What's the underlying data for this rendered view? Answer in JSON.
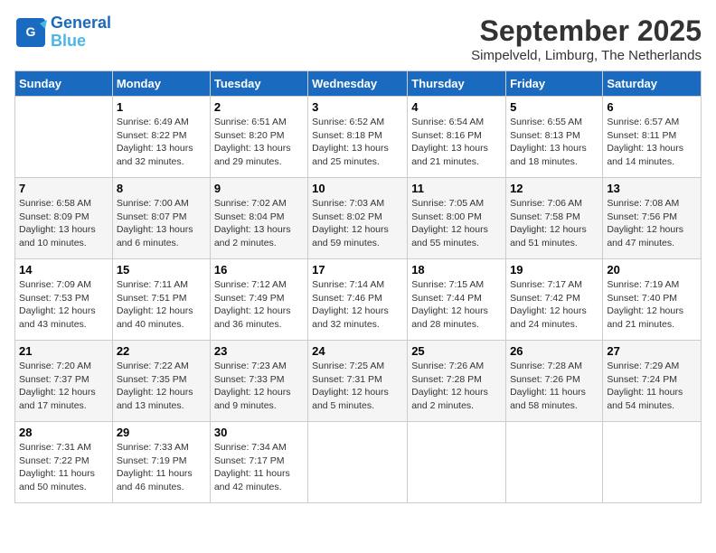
{
  "header": {
    "logo_line1": "General",
    "logo_line2": "Blue",
    "month": "September 2025",
    "location": "Simpelveld, Limburg, The Netherlands"
  },
  "days_of_week": [
    "Sunday",
    "Monday",
    "Tuesday",
    "Wednesday",
    "Thursday",
    "Friday",
    "Saturday"
  ],
  "weeks": [
    [
      {
        "day": "",
        "info": ""
      },
      {
        "day": "1",
        "info": "Sunrise: 6:49 AM\nSunset: 8:22 PM\nDaylight: 13 hours\nand 32 minutes."
      },
      {
        "day": "2",
        "info": "Sunrise: 6:51 AM\nSunset: 8:20 PM\nDaylight: 13 hours\nand 29 minutes."
      },
      {
        "day": "3",
        "info": "Sunrise: 6:52 AM\nSunset: 8:18 PM\nDaylight: 13 hours\nand 25 minutes."
      },
      {
        "day": "4",
        "info": "Sunrise: 6:54 AM\nSunset: 8:16 PM\nDaylight: 13 hours\nand 21 minutes."
      },
      {
        "day": "5",
        "info": "Sunrise: 6:55 AM\nSunset: 8:13 PM\nDaylight: 13 hours\nand 18 minutes."
      },
      {
        "day": "6",
        "info": "Sunrise: 6:57 AM\nSunset: 8:11 PM\nDaylight: 13 hours\nand 14 minutes."
      }
    ],
    [
      {
        "day": "7",
        "info": "Sunrise: 6:58 AM\nSunset: 8:09 PM\nDaylight: 13 hours\nand 10 minutes."
      },
      {
        "day": "8",
        "info": "Sunrise: 7:00 AM\nSunset: 8:07 PM\nDaylight: 13 hours\nand 6 minutes."
      },
      {
        "day": "9",
        "info": "Sunrise: 7:02 AM\nSunset: 8:04 PM\nDaylight: 13 hours\nand 2 minutes."
      },
      {
        "day": "10",
        "info": "Sunrise: 7:03 AM\nSunset: 8:02 PM\nDaylight: 12 hours\nand 59 minutes."
      },
      {
        "day": "11",
        "info": "Sunrise: 7:05 AM\nSunset: 8:00 PM\nDaylight: 12 hours\nand 55 minutes."
      },
      {
        "day": "12",
        "info": "Sunrise: 7:06 AM\nSunset: 7:58 PM\nDaylight: 12 hours\nand 51 minutes."
      },
      {
        "day": "13",
        "info": "Sunrise: 7:08 AM\nSunset: 7:56 PM\nDaylight: 12 hours\nand 47 minutes."
      }
    ],
    [
      {
        "day": "14",
        "info": "Sunrise: 7:09 AM\nSunset: 7:53 PM\nDaylight: 12 hours\nand 43 minutes."
      },
      {
        "day": "15",
        "info": "Sunrise: 7:11 AM\nSunset: 7:51 PM\nDaylight: 12 hours\nand 40 minutes."
      },
      {
        "day": "16",
        "info": "Sunrise: 7:12 AM\nSunset: 7:49 PM\nDaylight: 12 hours\nand 36 minutes."
      },
      {
        "day": "17",
        "info": "Sunrise: 7:14 AM\nSunset: 7:46 PM\nDaylight: 12 hours\nand 32 minutes."
      },
      {
        "day": "18",
        "info": "Sunrise: 7:15 AM\nSunset: 7:44 PM\nDaylight: 12 hours\nand 28 minutes."
      },
      {
        "day": "19",
        "info": "Sunrise: 7:17 AM\nSunset: 7:42 PM\nDaylight: 12 hours\nand 24 minutes."
      },
      {
        "day": "20",
        "info": "Sunrise: 7:19 AM\nSunset: 7:40 PM\nDaylight: 12 hours\nand 21 minutes."
      }
    ],
    [
      {
        "day": "21",
        "info": "Sunrise: 7:20 AM\nSunset: 7:37 PM\nDaylight: 12 hours\nand 17 minutes."
      },
      {
        "day": "22",
        "info": "Sunrise: 7:22 AM\nSunset: 7:35 PM\nDaylight: 12 hours\nand 13 minutes."
      },
      {
        "day": "23",
        "info": "Sunrise: 7:23 AM\nSunset: 7:33 PM\nDaylight: 12 hours\nand 9 minutes."
      },
      {
        "day": "24",
        "info": "Sunrise: 7:25 AM\nSunset: 7:31 PM\nDaylight: 12 hours\nand 5 minutes."
      },
      {
        "day": "25",
        "info": "Sunrise: 7:26 AM\nSunset: 7:28 PM\nDaylight: 12 hours\nand 2 minutes."
      },
      {
        "day": "26",
        "info": "Sunrise: 7:28 AM\nSunset: 7:26 PM\nDaylight: 11 hours\nand 58 minutes."
      },
      {
        "day": "27",
        "info": "Sunrise: 7:29 AM\nSunset: 7:24 PM\nDaylight: 11 hours\nand 54 minutes."
      }
    ],
    [
      {
        "day": "28",
        "info": "Sunrise: 7:31 AM\nSunset: 7:22 PM\nDaylight: 11 hours\nand 50 minutes."
      },
      {
        "day": "29",
        "info": "Sunrise: 7:33 AM\nSunset: 7:19 PM\nDaylight: 11 hours\nand 46 minutes."
      },
      {
        "day": "30",
        "info": "Sunrise: 7:34 AM\nSunset: 7:17 PM\nDaylight: 11 hours\nand 42 minutes."
      },
      {
        "day": "",
        "info": ""
      },
      {
        "day": "",
        "info": ""
      },
      {
        "day": "",
        "info": ""
      },
      {
        "day": "",
        "info": ""
      }
    ]
  ]
}
